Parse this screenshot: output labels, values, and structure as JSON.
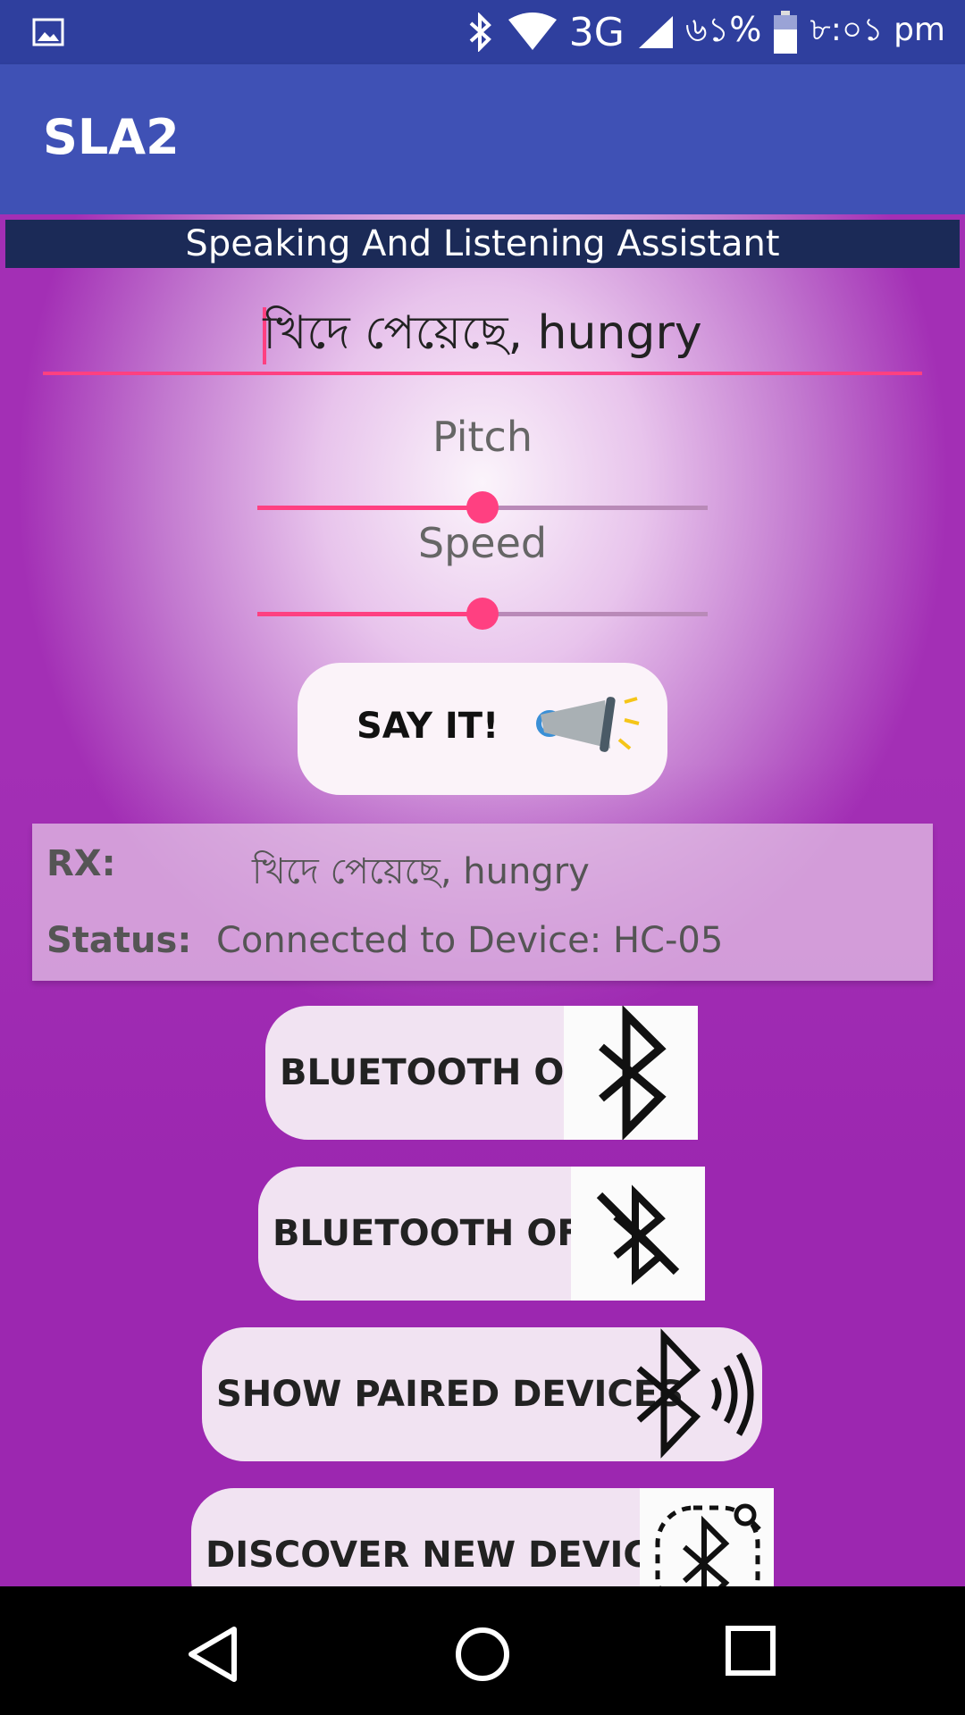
{
  "status_bar": {
    "network": "3G",
    "battery": "৬১%",
    "time": "৮:০১ pm",
    "icons": [
      "image-icon",
      "bluetooth-icon",
      "wifi-icon",
      "signal-icon",
      "battery-icon"
    ]
  },
  "app_bar": {
    "title": "SLA2"
  },
  "banner": {
    "text": "Speaking And Listening Assistant"
  },
  "input": {
    "value": "খিদে পেয়েছে, hungry"
  },
  "pitch": {
    "label": "Pitch",
    "value": 0.5
  },
  "speed": {
    "label": "Speed",
    "value": 0.5
  },
  "say_it": {
    "label": "SAY IT!",
    "icon": "megaphone-icon"
  },
  "info": {
    "rx_label": "RX:",
    "rx_value": "খিদে পেয়েছে, hungry",
    "status_label": "Status:",
    "status_value": "Connected to Device: HC-05"
  },
  "buttons": [
    {
      "label": "BLUETOOTH ON",
      "icon": "bluetooth-icon"
    },
    {
      "label": "BLUETOOTH OFF",
      "icon": "bluetooth-disabled-icon"
    },
    {
      "label": "SHOW PAIRED DEVICES",
      "icon": "bluetooth-audio-icon"
    },
    {
      "label": "DISCOVER NEW DEVICES",
      "icon": "bluetooth-search-icon"
    }
  ],
  "nav": [
    "back-icon",
    "home-icon",
    "recents-icon"
  ],
  "colors": {
    "primary": "#3f51b5",
    "primary_dark": "#2f3f9e",
    "accent": "#ff4081",
    "banner": "#1b2a57"
  }
}
